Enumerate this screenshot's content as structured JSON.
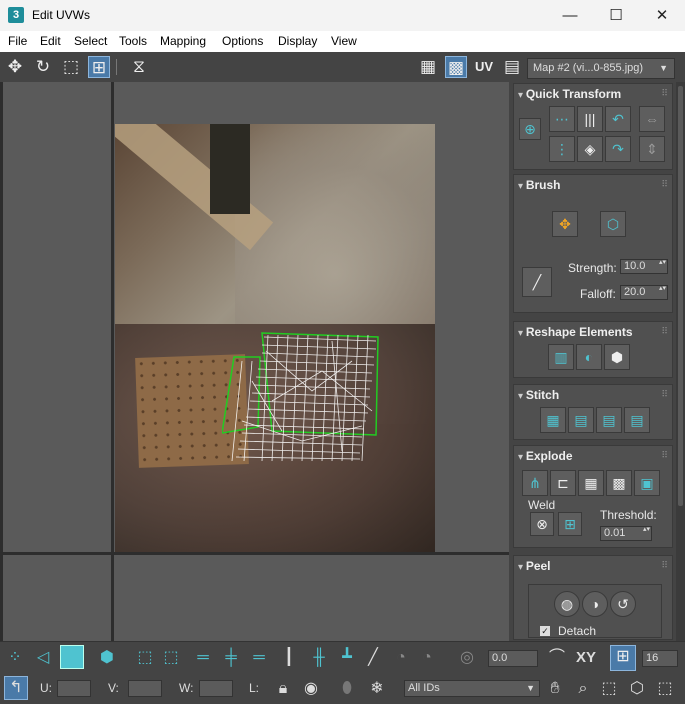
{
  "window": {
    "title": "Edit UVWs",
    "app_icon": "3",
    "min": "—",
    "max": "☐",
    "close": "✕"
  },
  "menu": [
    "File",
    "Edit",
    "Select",
    "Tools",
    "Mapping",
    "Options",
    "Display",
    "View"
  ],
  "toolbar": {
    "uv_label": "UV",
    "map_select": "Map #2 (vi...0-855.jpg)"
  },
  "panel": {
    "quick_transform": {
      "title": "Quick Transform"
    },
    "brush": {
      "title": "Brush",
      "strength_label": "Strength:",
      "strength_value": "10.0",
      "falloff_label": "Falloff:",
      "falloff_value": "20.0"
    },
    "reshape": {
      "title": "Reshape Elements"
    },
    "stitch": {
      "title": "Stitch"
    },
    "explode": {
      "title": "Explode",
      "weld_label": "Weld",
      "threshold_label": "Threshold:",
      "threshold_value": "0.01"
    },
    "peel": {
      "title": "Peel",
      "detach_label": "Detach"
    }
  },
  "bottom": {
    "angle_value": "0.0",
    "xy_label": "XY",
    "grid_value": "16",
    "u_label": "U:",
    "v_label": "V:",
    "w_label": "W:",
    "l_label": "L:",
    "ids_select": "All IDs"
  },
  "colors": {
    "accent": "#4fc3d0",
    "uv_edge": "#22cc22",
    "panel_bg": "#444444"
  }
}
